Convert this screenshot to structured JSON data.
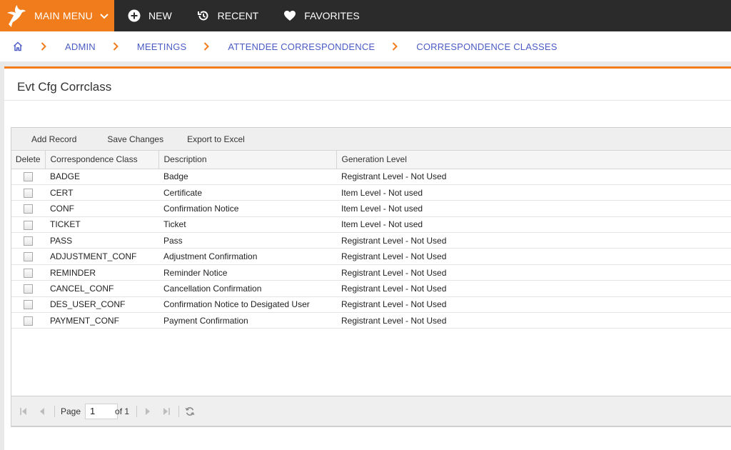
{
  "topbar": {
    "main_menu_label": "MAIN MENU",
    "new_label": "NEW",
    "recent_label": "RECENT",
    "favorites_label": "FAVORITES",
    "brand_color": "#f07c1b"
  },
  "breadcrumb": {
    "items": [
      "ADMIN",
      "MEETINGS",
      "ATTENDEE CORRESPONDENCE",
      "CORRESPONDENCE CLASSES"
    ]
  },
  "page": {
    "title": "Evt Cfg Corrclass"
  },
  "toolbar": {
    "add_record": "Add Record",
    "save_changes": "Save Changes",
    "export_excel": "Export to Excel"
  },
  "grid": {
    "columns": [
      "Delete",
      "Correspondence Class",
      "Description",
      "Generation Level"
    ],
    "rows": [
      {
        "cls": "BADGE",
        "desc": "Badge",
        "level": "Registrant Level - Not Used"
      },
      {
        "cls": "CERT",
        "desc": "Certificate",
        "level": "Item Level - Not used"
      },
      {
        "cls": "CONF",
        "desc": "Confirmation Notice",
        "level": "Item Level - Not used"
      },
      {
        "cls": "TICKET",
        "desc": "Ticket",
        "level": "Item Level - Not used"
      },
      {
        "cls": "PASS",
        "desc": "Pass",
        "level": "Registrant Level - Not Used"
      },
      {
        "cls": "ADJUSTMENT_CONF",
        "desc": "Adjustment Confirmation",
        "level": "Registrant Level - Not Used"
      },
      {
        "cls": "REMINDER",
        "desc": "Reminder Notice",
        "level": "Registrant Level - Not Used"
      },
      {
        "cls": "CANCEL_CONF",
        "desc": "Cancellation Confirmation",
        "level": "Registrant Level - Not Used"
      },
      {
        "cls": "DES_USER_CONF",
        "desc": "Confirmation Notice to Desigated User",
        "level": "Registrant Level - Not Used"
      },
      {
        "cls": "PAYMENT_CONF",
        "desc": "Payment Confirmation",
        "level": "Registrant Level - Not Used"
      }
    ]
  },
  "pager": {
    "page_label": "Page",
    "page_value": "1",
    "of_label": "of 1"
  }
}
